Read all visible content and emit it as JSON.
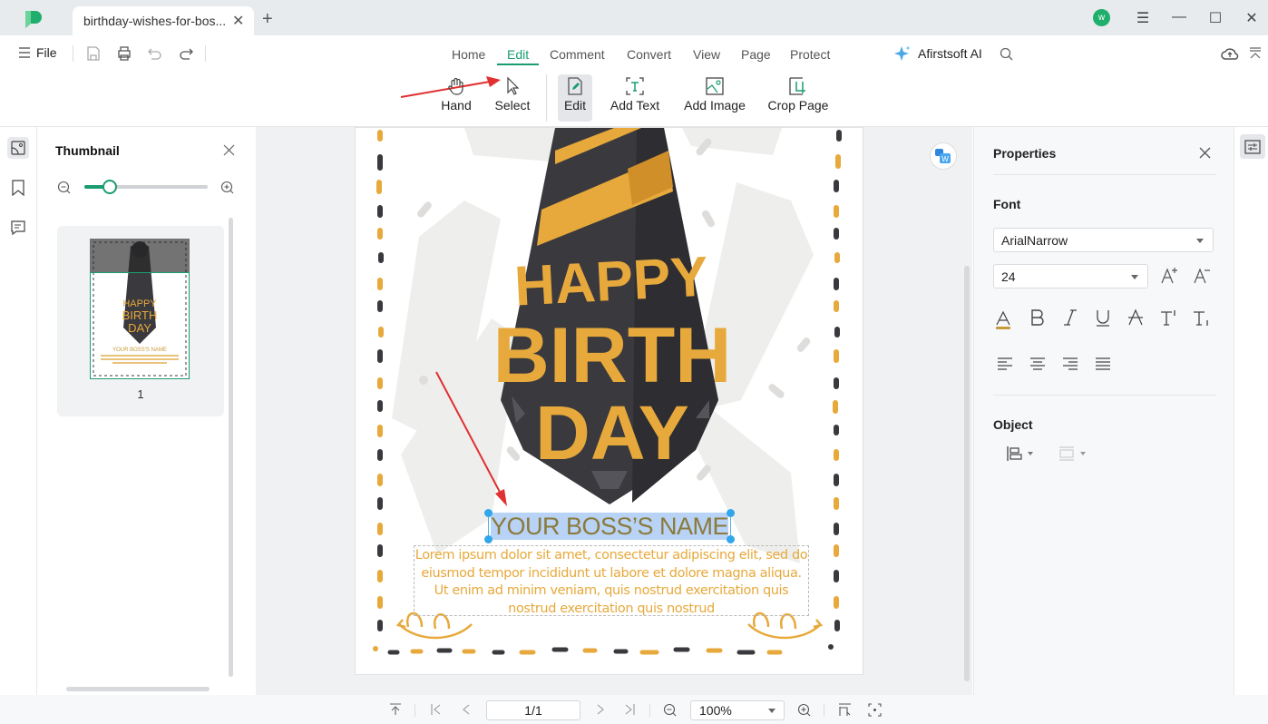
{
  "titlebar": {
    "tab_title": "birthday-wishes-for-bos...",
    "avatar_initial": "w",
    "new_tab_glyph": "+",
    "close_glyph": "✕",
    "win_menu_glyph": "☰",
    "win_min_glyph": "—",
    "win_max_glyph": "☐",
    "win_close_glyph": "✕"
  },
  "menubar": {
    "file_label": "File",
    "tabs": [
      {
        "label": "Home",
        "active": false
      },
      {
        "label": "Edit",
        "active": true
      },
      {
        "label": "Comment",
        "active": false
      },
      {
        "label": "Convert",
        "active": false
      },
      {
        "label": "View",
        "active": false
      },
      {
        "label": "Page",
        "active": false
      },
      {
        "label": "Protect",
        "active": false
      }
    ],
    "ai_label": "Afirstsoft AI"
  },
  "toolbar": {
    "tools": [
      {
        "label": "Hand",
        "icon": "hand-icon"
      },
      {
        "label": "Select",
        "icon": "cursor-icon"
      },
      {
        "label": "Edit",
        "icon": "edit-icon",
        "active": true
      },
      {
        "label": "Add Text",
        "icon": "add-text-icon"
      },
      {
        "label": "Add Image",
        "icon": "add-image-icon"
      },
      {
        "label": "Crop Page",
        "icon": "crop-icon"
      }
    ]
  },
  "thumbnail_panel": {
    "title": "Thumbnail",
    "zoom_slider_value": 0.2,
    "pages": [
      {
        "number": "1"
      }
    ]
  },
  "document": {
    "heading_line1": "HAPPY",
    "heading_line2": "BIRTH",
    "heading_line3": "DAY",
    "name_text": "YOUR BOSS’S NAME",
    "body_text": "Lorem ipsum dolor sit amet, consectetur adipiscing elit, sed do eiusmod tempor incididunt ut labore et dolore magna aliqua. Ut enim ad minim veniam, quis nostrud exercitation  quis nostrud exercitation quis nostrud",
    "colors": {
      "gold": "#e7a93b",
      "dark": "#3a393e",
      "name": "#8a7a3c",
      "selection": "#b8d3f5"
    }
  },
  "properties": {
    "title": "Properties",
    "font_section": "Font",
    "font_family": "ArialNarrow",
    "font_size": "24",
    "object_section": "Object",
    "format_buttons": [
      "text-color",
      "bold",
      "italic",
      "underline",
      "strikethrough",
      "superscript",
      "subscript"
    ],
    "align_buttons": [
      "align-left",
      "align-center",
      "align-right",
      "justify"
    ],
    "text_color": "#c99a3a"
  },
  "statusbar": {
    "page_value": "1/1",
    "zoom_value": "100%"
  },
  "accent_color": "#1a9d6e"
}
